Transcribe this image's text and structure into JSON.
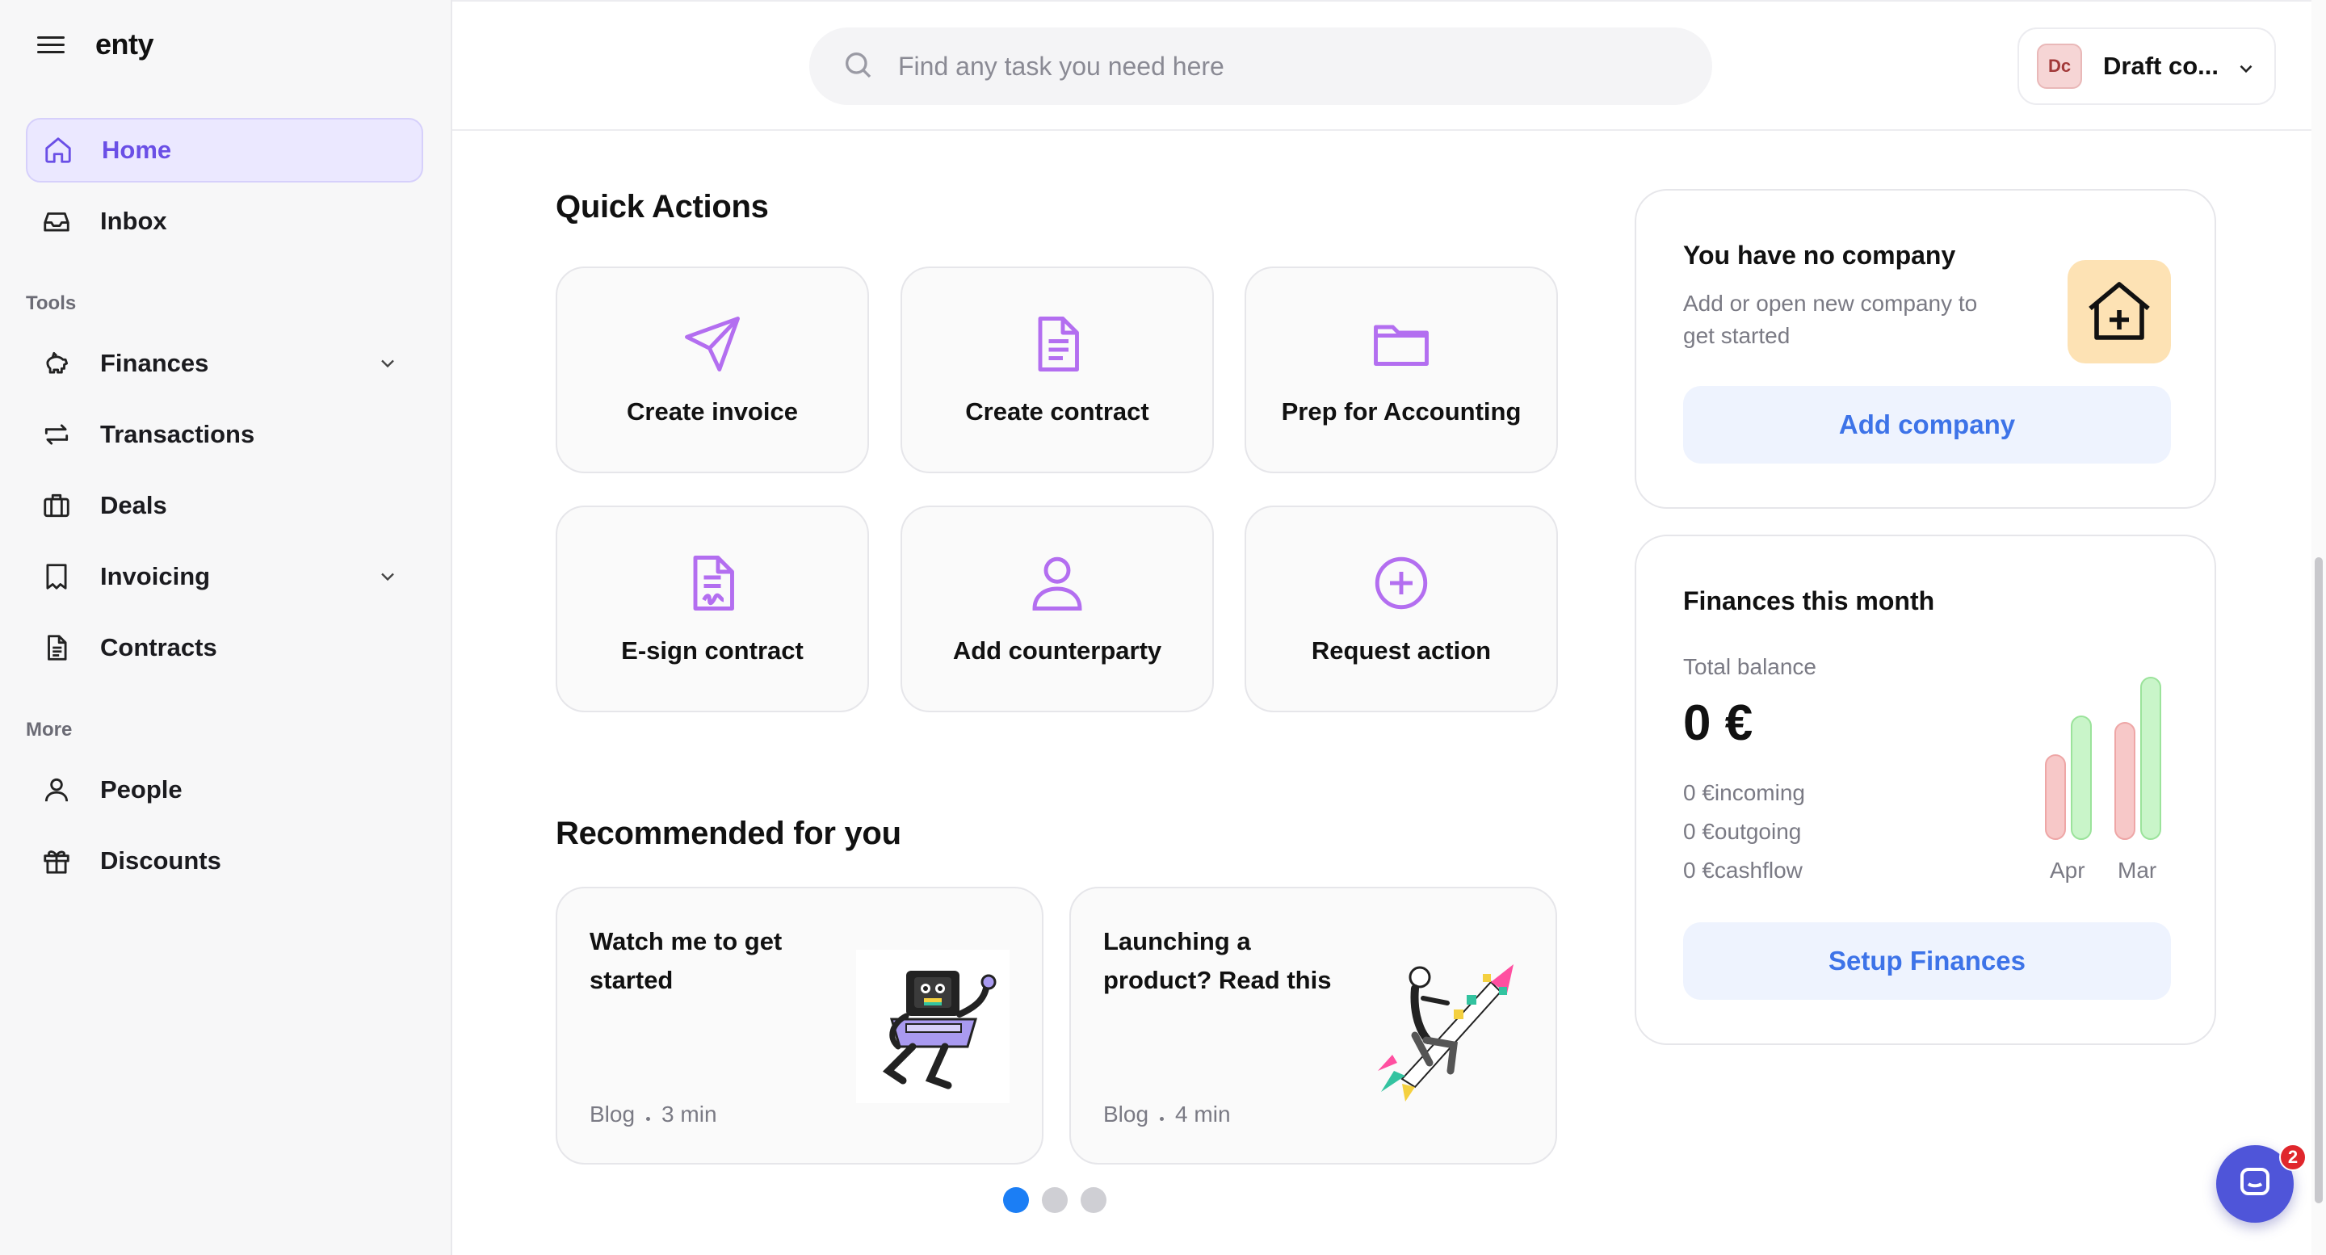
{
  "app": {
    "logo": "enty"
  },
  "sidebar": {
    "items": [
      {
        "label": "Home",
        "icon": "home-icon"
      },
      {
        "label": "Inbox",
        "icon": "inbox-icon"
      },
      {
        "label": "Finances",
        "icon": "piggy-bank-icon"
      },
      {
        "label": "Transactions",
        "icon": "transfer-arrows-icon"
      },
      {
        "label": "Deals",
        "icon": "briefcase-icon"
      },
      {
        "label": "Invoicing",
        "icon": "receipt-icon"
      },
      {
        "label": "Contracts",
        "icon": "document-icon"
      },
      {
        "label": "People",
        "icon": "person-icon"
      },
      {
        "label": "Discounts",
        "icon": "gift-icon"
      }
    ],
    "sections": {
      "tools": "Tools",
      "more": "More"
    }
  },
  "header": {
    "search_placeholder": "Find any task you need here",
    "company": {
      "initials": "Dc",
      "name": "Draft co..."
    }
  },
  "quick_actions": {
    "title": "Quick Actions",
    "items": [
      {
        "label": "Create invoice",
        "icon": "paper-plane-icon"
      },
      {
        "label": "Create contract",
        "icon": "document-icon"
      },
      {
        "label": "Prep for Accounting",
        "icon": "folder-icon"
      },
      {
        "label": "E-sign contract",
        "icon": "signature-document-icon"
      },
      {
        "label": "Add counterparty",
        "icon": "user-icon"
      },
      {
        "label": "Request action",
        "icon": "plus-circle-icon"
      }
    ]
  },
  "recommended": {
    "title": "Recommended for you",
    "items": [
      {
        "title": "Watch me to get started",
        "type": "Blog",
        "duration": "3 min"
      },
      {
        "title": "Launching a product? Read this",
        "type": "Blog",
        "duration": "4 min"
      }
    ]
  },
  "company_card": {
    "title": "You have no company",
    "desc": "Add or open new company to get started",
    "button": "Add company"
  },
  "finances_card": {
    "title": "Finances this month",
    "balance_label": "Total balance",
    "balance": "0 €",
    "incoming": "0 €incoming",
    "outgoing": "0 €outgoing",
    "cashflow": "0 €cashflow",
    "months": [
      "Apr",
      "Mar"
    ],
    "button": "Setup Finances"
  },
  "chat": {
    "badge": "2"
  },
  "colors": {
    "accent": "#6a4fe6",
    "link_blue": "#3d73e8",
    "icon_purple": "#b36ef0"
  }
}
